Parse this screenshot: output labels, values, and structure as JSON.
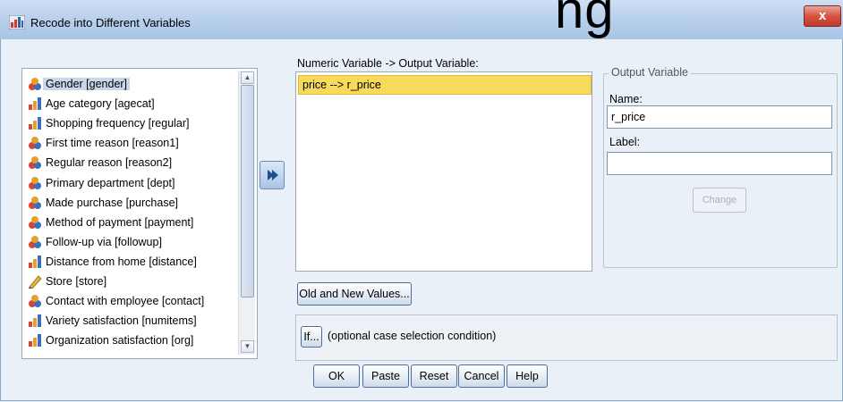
{
  "window": {
    "title": "Recode into Different Variables",
    "background_heading": "ng",
    "close_label": "x"
  },
  "variables": [
    {
      "label": "Gender [gender]",
      "icon": "nominal-icon",
      "selected": true
    },
    {
      "label": "Age category [agecat]",
      "icon": "ordinal-icon"
    },
    {
      "label": "Shopping frequency [regular]",
      "icon": "ordinal-icon"
    },
    {
      "label": "First time reason [reason1]",
      "icon": "nominal-icon"
    },
    {
      "label": "Regular reason [reason2]",
      "icon": "nominal-icon"
    },
    {
      "label": "Primary department [dept]",
      "icon": "nominal-icon"
    },
    {
      "label": "Made purchase [purchase]",
      "icon": "nominal-icon"
    },
    {
      "label": "Method of payment [payment]",
      "icon": "nominal-icon"
    },
    {
      "label": "Follow-up via [followup]",
      "icon": "nominal-icon"
    },
    {
      "label": "Distance from home [distance]",
      "icon": "ordinal-icon"
    },
    {
      "label": "Store [store]",
      "icon": "scale-icon"
    },
    {
      "label": "Contact with employee [contact]",
      "icon": "nominal-icon"
    },
    {
      "label": "Variety satisfaction [numitems]",
      "icon": "ordinal-icon"
    },
    {
      "label": "Organization satisfaction [org]",
      "icon": "ordinal-icon"
    }
  ],
  "numeric_section": {
    "label": "Numeric Variable -> Output Variable:",
    "items": [
      "price --> r_price"
    ]
  },
  "output_variable": {
    "title": "Output Variable",
    "name_label": "Name:",
    "name_value": "r_price",
    "label_label": "Label:",
    "label_value": "",
    "change_button": "Change"
  },
  "buttons": {
    "old_new": "Old and New Values...",
    "if": "If...",
    "if_hint": "(optional case selection condition)",
    "ok": "OK",
    "paste": "Paste",
    "reset": "Reset",
    "cancel": "Cancel",
    "help": "Help"
  },
  "colors": {
    "selection_highlight": "#f7d95b",
    "title_bar": "#b9d1ec",
    "close_button": "#c0392b"
  }
}
